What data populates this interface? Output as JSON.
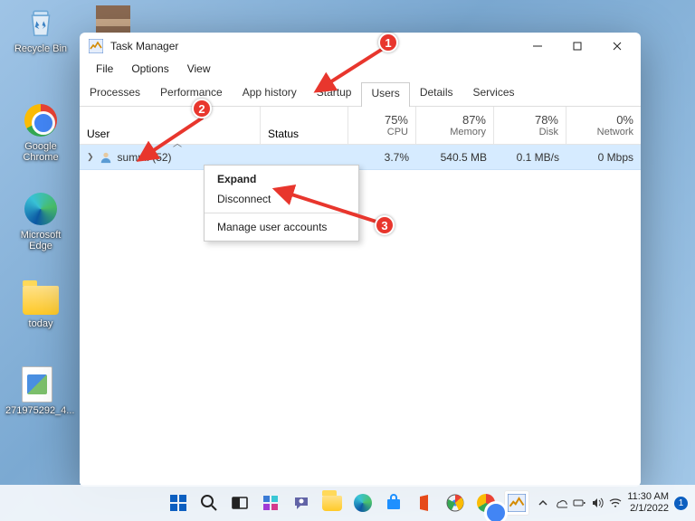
{
  "desktop": {
    "icons": [
      {
        "label": "Recycle Bin"
      },
      {
        "label": ""
      },
      {
        "label": "Google Chrome"
      },
      {
        "label": "Microsoft Edge"
      },
      {
        "label": "today"
      },
      {
        "label": "271975292_4..."
      }
    ]
  },
  "window": {
    "title": "Task Manager",
    "menu": [
      "File",
      "Options",
      "View"
    ],
    "tabs": [
      "Processes",
      "Performance",
      "App history",
      "Startup",
      "Users",
      "Details",
      "Services"
    ],
    "active_tab": "Users",
    "columns": {
      "user": "User",
      "status": "Status",
      "cpu": {
        "pct": "75%",
        "label": "CPU"
      },
      "mem": {
        "pct": "87%",
        "label": "Memory"
      },
      "disk": {
        "pct": "78%",
        "label": "Disk"
      },
      "net": {
        "pct": "0%",
        "label": "Network"
      }
    },
    "rows": [
      {
        "user": "summi (52)",
        "status": "",
        "cpu": "3.7%",
        "mem": "540.5 MB",
        "disk": "0.1 MB/s",
        "net": "0 Mbps"
      }
    ]
  },
  "context_menu": [
    "Expand",
    "Disconnect",
    "Manage user accounts"
  ],
  "annotations": {
    "1": "1",
    "2": "2",
    "3": "3"
  },
  "taskbar": {
    "clock_time": "11:30 AM",
    "clock_date": "2/1/2022",
    "notif_count": "1"
  }
}
